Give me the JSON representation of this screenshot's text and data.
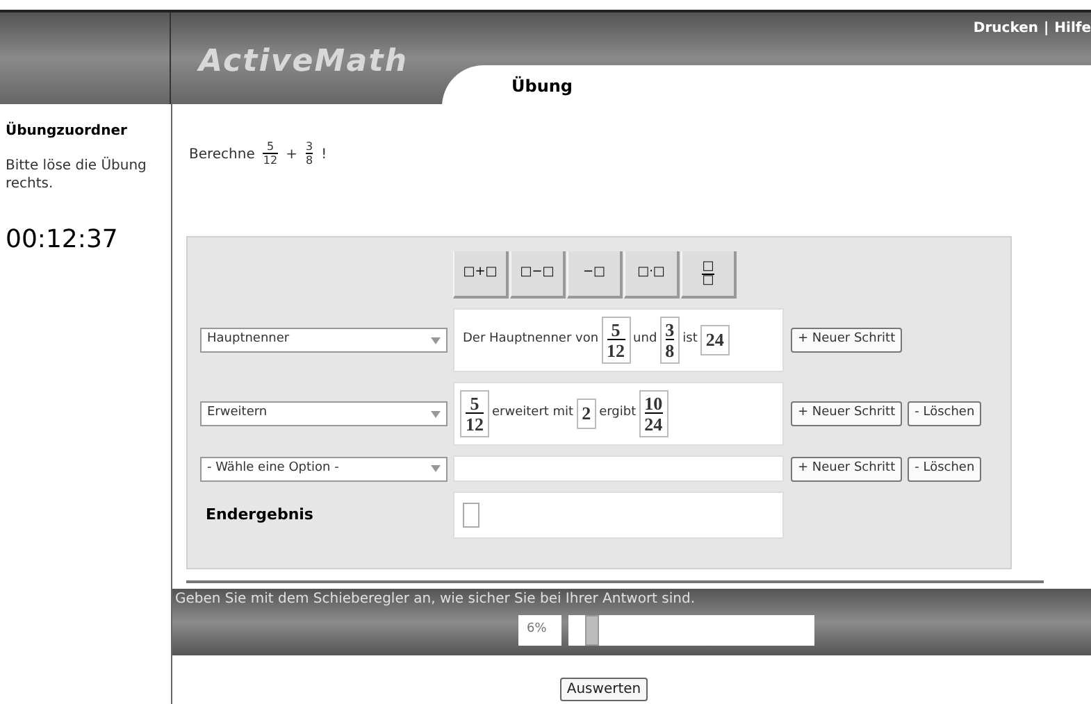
{
  "header": {
    "logo": "ActiveMath",
    "tab": "Übung",
    "links": [
      "Drucken",
      "Hilfe"
    ],
    "separator": "|"
  },
  "sidebar": {
    "title": "Übungzuordner",
    "text": "Bitte löse die Übung rechts.",
    "timer": "00:12:37"
  },
  "task": {
    "segments": [
      {
        "kind": "text",
        "text": "Berechne"
      },
      {
        "kind": "fraction",
        "num": "5",
        "den": "12"
      },
      {
        "kind": "text",
        "text": "+"
      },
      {
        "kind": "fraction",
        "num": "3",
        "den": "8"
      },
      {
        "kind": "text",
        "text": "!"
      }
    ]
  },
  "operators": [
    {
      "kind": "text",
      "text": "□+□"
    },
    {
      "kind": "text",
      "text": "□−□"
    },
    {
      "kind": "text",
      "text": "−□"
    },
    {
      "kind": "text",
      "text": "□·□"
    },
    {
      "kind": "fraction",
      "num": "□",
      "den": "□"
    }
  ],
  "steps": [
    {
      "select": "Hauptnenner",
      "segments": [
        {
          "kind": "text",
          "text": "Der Hauptnenner von"
        },
        {
          "kind": "fraction",
          "num": "5",
          "den": "12"
        },
        {
          "kind": "text",
          "text": "und"
        },
        {
          "kind": "fraction",
          "num": "3",
          "den": "8"
        },
        {
          "kind": "text",
          "text": "ist"
        },
        {
          "kind": "box",
          "text": "24"
        }
      ],
      "buttons": [
        "+ Neuer Schritt"
      ]
    },
    {
      "select": "Erweitern",
      "segments": [
        {
          "kind": "fraction",
          "num": "5",
          "den": "12"
        },
        {
          "kind": "text",
          "text": "erweitert mit"
        },
        {
          "kind": "box",
          "text": "2"
        },
        {
          "kind": "text",
          "text": "ergibt"
        },
        {
          "kind": "fraction",
          "num": "10",
          "den": "24"
        }
      ],
      "buttons": [
        "+ Neuer Schritt",
        "- Löschen"
      ]
    },
    {
      "select": "- Wähle eine Option -",
      "buttons": [
        "+ Neuer Schritt",
        "- Löschen"
      ]
    }
  ],
  "result": {
    "label": "Endergebnis"
  },
  "confidence": {
    "prompt": "Geben Sie mit dem Schieberegler an, wie sicher Sie bei Ihrer Antwort sind.",
    "reading": "6%",
    "level": 0.06
  },
  "submit": "Auswerten"
}
